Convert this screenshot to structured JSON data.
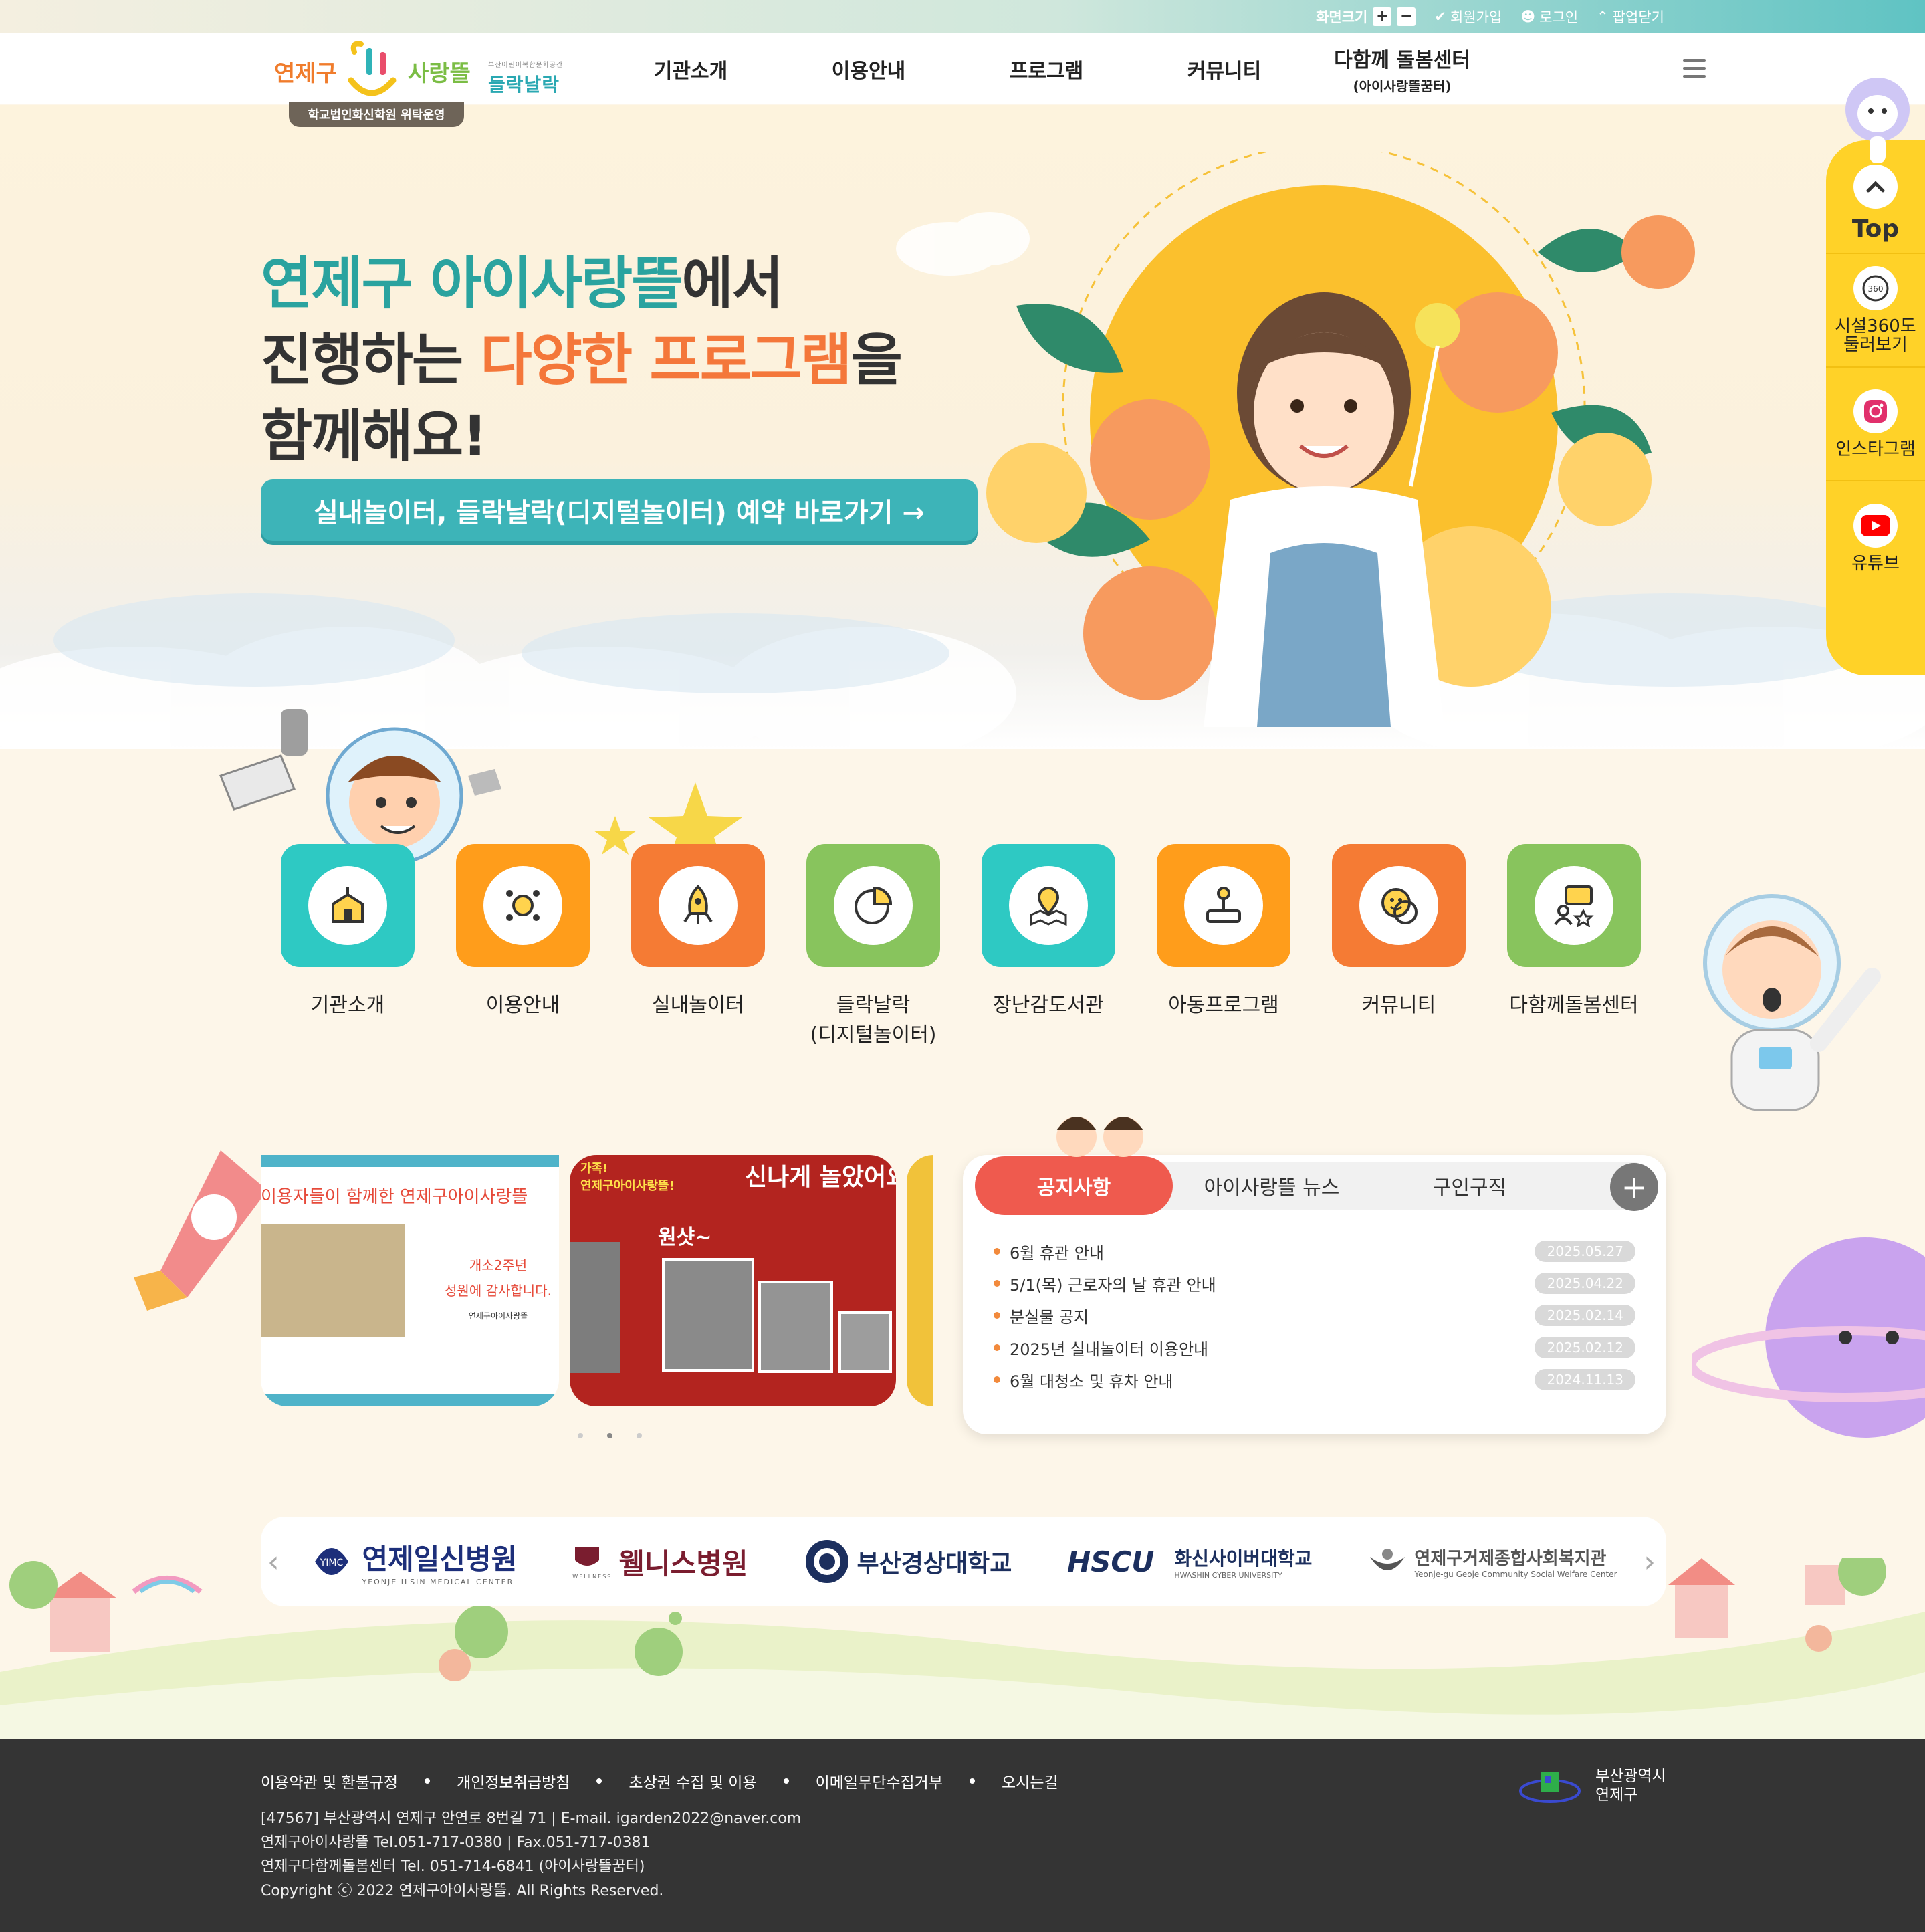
{
  "topbar": {
    "zoom_label": "화면크기",
    "zoom_in": "+",
    "zoom_out": "−",
    "signup": "회원가입",
    "login": "로그인",
    "popup_close": "팝업닫기"
  },
  "header": {
    "logo_part1": "연제구",
    "logo_part2": "사랑뜰",
    "logo_sub_small": "부산어린이복합문화공간",
    "logo_brand2": "들락날락",
    "sub_badge": "학교법인화신학원 위탁운영",
    "nav": [
      {
        "label": "기관소개",
        "sub": ""
      },
      {
        "label": "이용안내",
        "sub": ""
      },
      {
        "label": "프로그램",
        "sub": ""
      },
      {
        "label": "커뮤니티",
        "sub": ""
      },
      {
        "label": "다함께 돌봄센터",
        "sub": "(아이사랑뜰꿈터)"
      }
    ]
  },
  "hero": {
    "line1_highlight": "연제구 아이사랑뜰",
    "line1_rest": "에서",
    "line2_pre": "진행하는 ",
    "line2_highlight": "다양한 프로그램",
    "line2_rest": "을",
    "line3": "함께해요!",
    "cta": "실내놀이터, 들락날락(디지털놀이터) 예약 바로가기 →"
  },
  "quick_menu": [
    {
      "label": "Top",
      "icon": "chevron-up-icon"
    },
    {
      "label": "시설360도 둘러보기",
      "icon": "view-360-icon"
    },
    {
      "label": "인스타그램",
      "icon": "instagram-icon"
    },
    {
      "label": "유튜브",
      "icon": "youtube-icon"
    }
  ],
  "quick_icons": [
    {
      "label": "기관소개",
      "color": "#2ec9c3",
      "icon": "building-icon"
    },
    {
      "label": "이용안내",
      "color": "#ff9d1b",
      "icon": "guide-icon"
    },
    {
      "label": "실내놀이터",
      "color": "#f57b34",
      "icon": "rocket-icon"
    },
    {
      "label": "들락날락\n(디지털놀이터)",
      "color": "#88c45d",
      "icon": "pie-chart-icon"
    },
    {
      "label": "장난감도서관",
      "color": "#2ec9c3",
      "icon": "map-pin-icon"
    },
    {
      "label": "아동프로그램",
      "color": "#ff9d1b",
      "icon": "joystick-icon"
    },
    {
      "label": "커뮤니티",
      "color": "#f57b34",
      "icon": "smile-icon"
    },
    {
      "label": "다함께돌봄센터",
      "color": "#88c45d",
      "icon": "people-icon"
    }
  ],
  "gallery": {
    "card1_title": "이용자들이 함께한 연제구아이사랑뜰",
    "card1_msg1": "개소2주년",
    "card1_msg2": "성원에 감사합니다.",
    "card1_sign": "연제구아이사랑뜰",
    "card2_title": "신나게 놀았어요",
    "card2_tag": "가족!",
    "card2_sub": "연제구아이사랑뜰!",
    "card2_shout": "원샷~"
  },
  "board": {
    "tabs": [
      "공지사항",
      "아이사랑뜰 뉴스",
      "구인구직"
    ],
    "more": "+",
    "items": [
      {
        "title": "6월 휴관 안내",
        "date": "2025.05.27"
      },
      {
        "title": "5/1(목) 근로자의 날 휴관 안내",
        "date": "2025.04.22"
      },
      {
        "title": "분실물 공지",
        "date": "2025.02.14"
      },
      {
        "title": "2025년 실내놀이터 이용안내",
        "date": "2025.02.12"
      },
      {
        "title": "6월 대청소 및 휴차 안내",
        "date": "2024.11.13"
      }
    ]
  },
  "partners": [
    {
      "name": "연제일신병원",
      "sub": "YEONJE ILSIN MEDICAL CENTER",
      "color": "#1d2f7a"
    },
    {
      "name": "웰니스병원",
      "sub": "WELLNESS",
      "color": "#7a1d2f"
    },
    {
      "name": "부산경상대학교",
      "sub": "",
      "color": "#1c2f5e"
    },
    {
      "name": "화신사이버대학교",
      "sub": "HWASHIN CYBER UNIVERSITY",
      "color": "#1c2f5e"
    },
    {
      "name": "연제구거제종합사회복지관",
      "sub": "Yeonje-gu Geoje Community Social Welfare Center",
      "color": "#555555"
    }
  ],
  "footer": {
    "links": [
      "이용약관 및 환불규정",
      "개인정보취급방침",
      "초상권 수집 및 이용",
      "이메일무단수집거부",
      "오시는길"
    ],
    "address": "[47567] 부산광역시 연제구 안연로 8번길 71  |  E-mail. igarden2022@naver.com",
    "tel": "연제구아이사랑뜰 Tel.051-717-0380  |  Fax.051-717-0381",
    "tel2": "연제구다함께돌봄센터 Tel. 051-714-6841 (아이사랑뜰꿈터)",
    "copyright": "Copyright ⓒ 2022 연제구아이사랑뜰. All Rights Reserved.",
    "org_line1": "부산광역시",
    "org_line2": "연제구"
  }
}
